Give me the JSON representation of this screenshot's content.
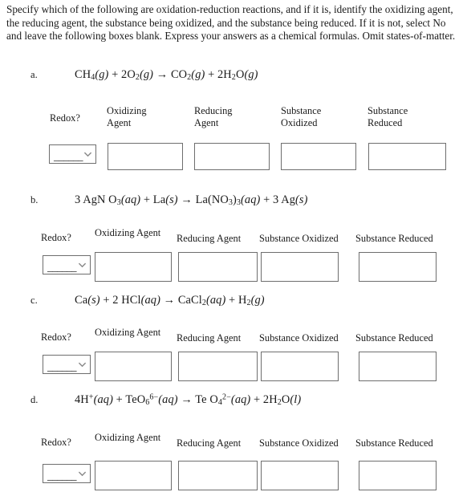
{
  "instructions": "Specify which of the following are oxidation-reduction reactions, and if it is, identify the oxidizing agent, the reducing agent, the substance being oxidized, and the substance being reduced. If it is not, select No and leave the following boxes blank. Express your answers as a chemical formulas. Omit states-of-matter.",
  "headers": {
    "redox": "Redox?",
    "oxidizing_agent": "Oxidizing Agent",
    "oxidizing_agent_line1": "Oxidizing",
    "oxidizing_agent_line2": "Agent",
    "reducing_agent": "Reducing Agent",
    "reducing_agent_line1": "Reducing",
    "reducing_agent_line2": "Agent",
    "substance_oxidized": "Substance Oxidized",
    "substance_oxidized_line1": "Substance",
    "substance_oxidized_line2": "Oxidized",
    "substance_reduced": "Substance Reduced",
    "substance_reduced_line1": "Substance",
    "substance_reduced_line2": "Reduced"
  },
  "select_placeholder": "______",
  "select_icon": "chevron-down-icon",
  "colors": {
    "background": "#ffffff",
    "text": "#1a1a1a",
    "box_border": "#6e6e6e",
    "chevron": "#8a8a8a"
  },
  "problems": [
    {
      "label": "a.",
      "equation_text": "CH4 (g) + 2 O2 (g) -> CO2 (g) + 2 H2O (g)",
      "redox_value": "",
      "oxidizing_agent_value": "",
      "reducing_agent_value": "",
      "substance_oxidized_value": "",
      "substance_reduced_value": ""
    },
    {
      "label": "b.",
      "equation_text": "3 AgNO3 (aq) + La (s) -> La(NO3)3 (aq) + 3 Ag (s)",
      "redox_value": "",
      "oxidizing_agent_value": "",
      "reducing_agent_value": "",
      "substance_oxidized_value": "",
      "substance_reduced_value": ""
    },
    {
      "label": "c.",
      "equation_text": "Ca (s) + 2 HCl (aq) -> CaCl2 (aq) + H2 (g)",
      "redox_value": "",
      "oxidizing_agent_value": "",
      "reducing_agent_value": "",
      "substance_oxidized_value": "",
      "substance_reduced_value": ""
    },
    {
      "label": "d.",
      "equation_text": "4 H+ (aq) + TeO6 6- (aq) -> TeO4 2- (aq) + 2 H2O (l)",
      "redox_value": "",
      "oxidizing_agent_value": "",
      "reducing_agent_value": "",
      "substance_oxidized_value": "",
      "substance_reduced_value": ""
    }
  ]
}
